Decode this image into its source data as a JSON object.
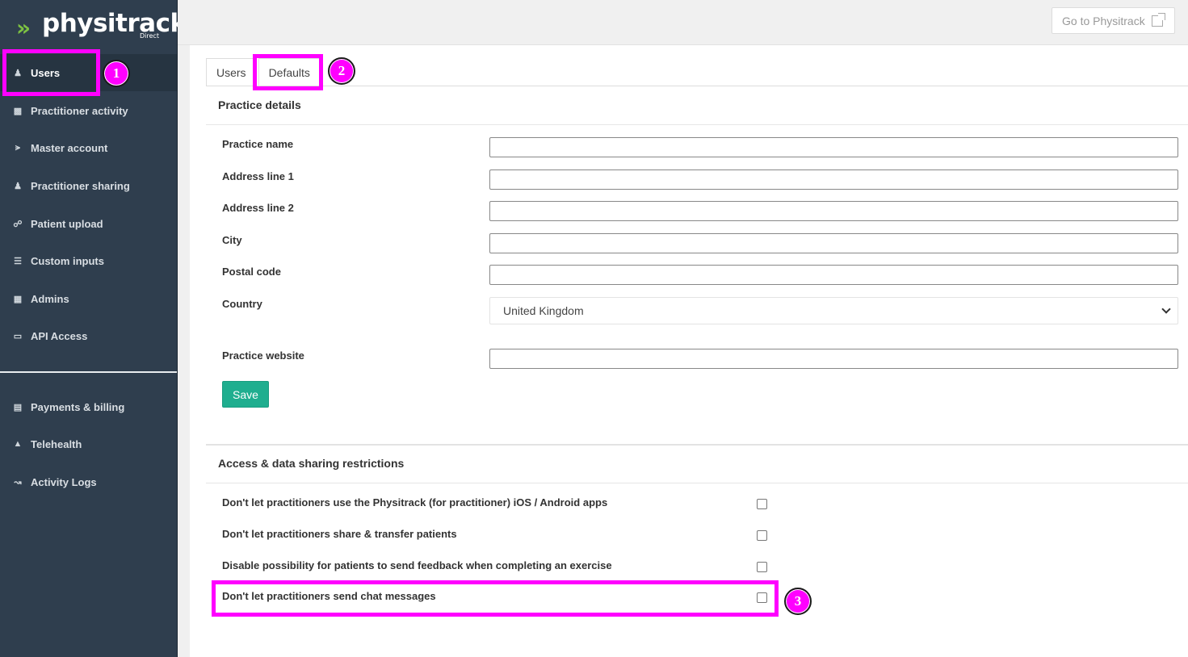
{
  "brand": {
    "logo_text": "physitrack",
    "logo_sub": "Direct",
    "accent": "#7dc242"
  },
  "sidebar": {
    "items": [
      {
        "label": "Users",
        "icon": "users-icon"
      },
      {
        "label": "Practitioner activity",
        "icon": "bar-chart-icon"
      },
      {
        "label": "Master account",
        "icon": "share-icon"
      },
      {
        "label": "Practitioner sharing",
        "icon": "user-icon"
      },
      {
        "label": "Patient upload",
        "icon": "link-icon"
      },
      {
        "label": "Custom inputs",
        "icon": "list-icon"
      },
      {
        "label": "Admins",
        "icon": "building-icon"
      },
      {
        "label": "API Access",
        "icon": "monitor-icon"
      }
    ],
    "items2": [
      {
        "label": "Payments & billing",
        "icon": "document-icon"
      },
      {
        "label": "Telehealth",
        "icon": "video-camera-icon"
      },
      {
        "label": "Activity Logs",
        "icon": "line-chart-icon"
      }
    ]
  },
  "topbar": {
    "goto_label": "Go to Physitrack"
  },
  "tabs": [
    {
      "label": "Users"
    },
    {
      "label": "Defaults"
    }
  ],
  "practice": {
    "title": "Practice details",
    "fields": {
      "name": {
        "label": "Practice name",
        "value": ""
      },
      "address1": {
        "label": "Address line 1",
        "value": ""
      },
      "address2": {
        "label": "Address line 2",
        "value": ""
      },
      "city": {
        "label": "City",
        "value": ""
      },
      "postal": {
        "label": "Postal code",
        "value": ""
      },
      "country": {
        "label": "Country",
        "value": "United Kingdom"
      },
      "website": {
        "label": "Practice website",
        "value": ""
      }
    },
    "save_label": "Save"
  },
  "restrictions": {
    "title": "Access & data sharing restrictions",
    "items": [
      {
        "label": "Don't let practitioners use the Physitrack (for practitioner) iOS / Android apps",
        "checked": false
      },
      {
        "label": "Don't let practitioners share & transfer patients",
        "checked": false
      },
      {
        "label": "Disable possibility for patients to send feedback when completing an exercise",
        "checked": false
      },
      {
        "label": "Don't let practitioners send chat messages",
        "checked": false
      }
    ]
  },
  "annotations": {
    "badge1": "1",
    "badge2": "2",
    "badge3": "3",
    "color": "#ff00ff"
  }
}
